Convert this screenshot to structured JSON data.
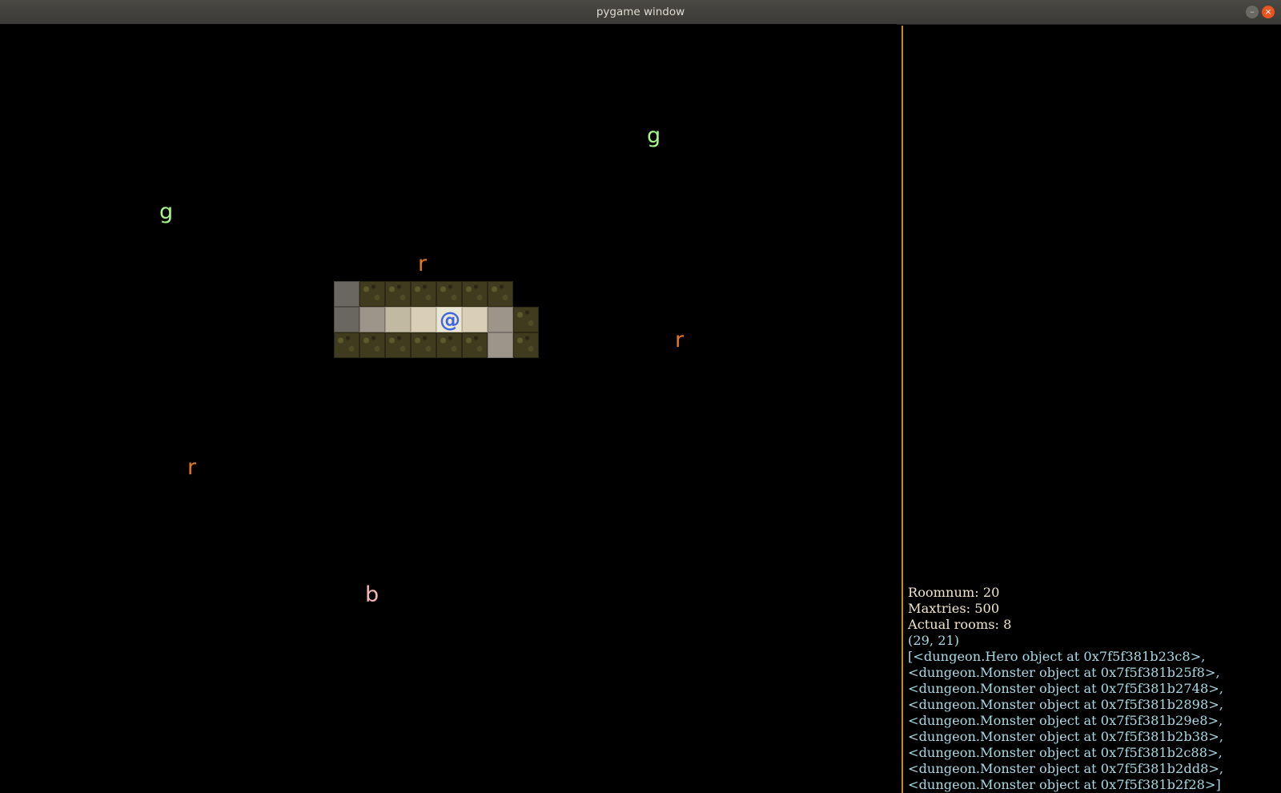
{
  "window": {
    "title": "pygame window",
    "minimize_icon": "minimize-icon",
    "close_icon": "close-icon"
  },
  "colors": {
    "goblin": "#a8f58c",
    "rat": "#e5781c",
    "bat": "#f5b6b6",
    "hero": "#3c67e0",
    "divider": "#c88a1e",
    "stat_text": "#f2e6cc",
    "object_text": "#a9dbe6"
  },
  "map": {
    "glyphs": {
      "goblin": "g",
      "rat": "r",
      "bat": "b",
      "hero": "@"
    }
  },
  "info": {
    "roomnum": "Roomnum: 20",
    "maxtries": "Maxtries: 500",
    "actual_rooms": "Actual rooms: 8",
    "position": "(29, 21)",
    "objects": [
      "[<dungeon.Hero object at 0x7f5f381b23c8>,",
      "<dungeon.Monster object at 0x7f5f381b25f8>,",
      "<dungeon.Monster object at 0x7f5f381b2748>,",
      "<dungeon.Monster object at 0x7f5f381b2898>,",
      "<dungeon.Monster object at 0x7f5f381b29e8>,",
      "<dungeon.Monster object at 0x7f5f381b2b38>,",
      "<dungeon.Monster object at 0x7f5f381b2c88>,",
      "<dungeon.Monster object at 0x7f5f381b2dd8>,",
      "<dungeon.Monster object at 0x7f5f381b2f28>]"
    ]
  }
}
